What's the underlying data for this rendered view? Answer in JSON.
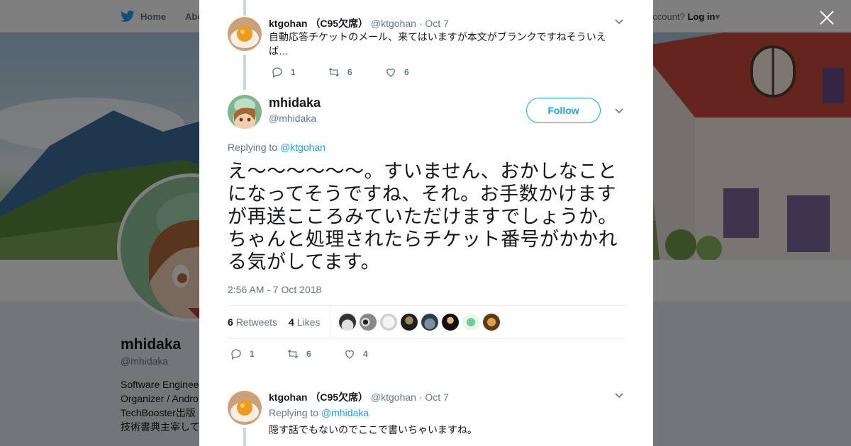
{
  "nav": {
    "home_label": "Home",
    "about_label": "Abo",
    "account_prompt": "account?",
    "login_label": "Log in"
  },
  "profile": {
    "name": "mhidaka",
    "handle": "@mhidaka",
    "bio": [
      "Software Enginee",
      "Organizer / Andro",
      "TechBooster出版",
      "技術書典主宰して"
    ]
  },
  "thread": {
    "prev_tweet": {
      "fullname": "ktgohan （C95欠席）",
      "handle": "@ktgohan",
      "date": "· Oct 7",
      "text": "自動応答チケットのメール、来てはいますが本文がブランクですねそういえば…",
      "replies": "1",
      "retweets": "6",
      "likes": "6"
    },
    "main_tweet": {
      "fullname": "mhidaka",
      "handle": "@mhidaka",
      "follow_label": "Follow",
      "replying_prefix": "Replying to",
      "replying_to": "@ktgohan",
      "text": "え～～～～～～。すいません、おかしなことになってそうですね、それ。お手数かけますが再送こころみていただけますでしょうか。ちゃんと処理されたらチケット番号がかかれる気がしてます。",
      "timestamp": "2:56 AM - 7 Oct 2018",
      "retweet_count": "6",
      "retweet_label": "Retweets",
      "like_count": "4",
      "like_label": "Likes",
      "replies": "1",
      "retweets": "6",
      "likes": "4"
    },
    "next_tweet": {
      "fullname": "ktgohan （C95欠席）",
      "handle": "@ktgohan",
      "date": "· Oct 7",
      "replying_prefix": "Replying to",
      "replying_to": "@mhidaka",
      "text": "隠す話でもないのでここで書いちゃいますね。"
    }
  },
  "colors": {
    "accent": "#1da1f2",
    "muted": "#657786",
    "like_heart": "#657786"
  }
}
